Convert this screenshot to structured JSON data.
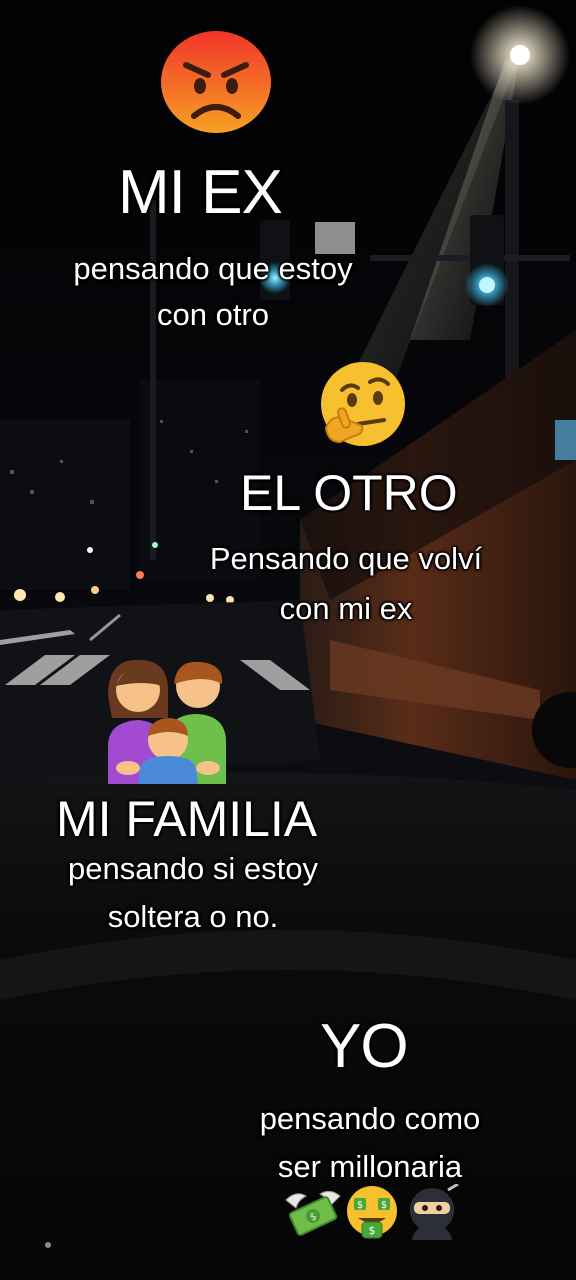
{
  "sections": [
    {
      "emoji": "angry-face-icon",
      "title": "MI EX",
      "subtitle_lines": [
        "pensando que estoy",
        "con otro"
      ]
    },
    {
      "emoji": "thinking-face-icon",
      "title": "EL OTRO",
      "subtitle_lines": [
        "Pensando que volví",
        "con mi ex"
      ]
    },
    {
      "emoji": "family-icon",
      "title": "MI FAMILIA",
      "subtitle_lines": [
        "pensando si estoy",
        "soltera o no."
      ]
    },
    {
      "emoji": "",
      "title": "YO",
      "subtitle_lines": [
        "pensando como",
        "ser millonaria"
      ]
    }
  ],
  "bottom_emojis": [
    "money-with-wings-icon",
    "money-mouth-face-icon",
    "ninja-icon"
  ],
  "background_scene": "night-street-from-car",
  "colors": {
    "text": "#ffffff",
    "emoji_yellow": "#f7c02e",
    "angry_red": "#f05a1e",
    "traffic_light_green": "#3fd0ff",
    "bus_orange": "#8a3a1a"
  }
}
